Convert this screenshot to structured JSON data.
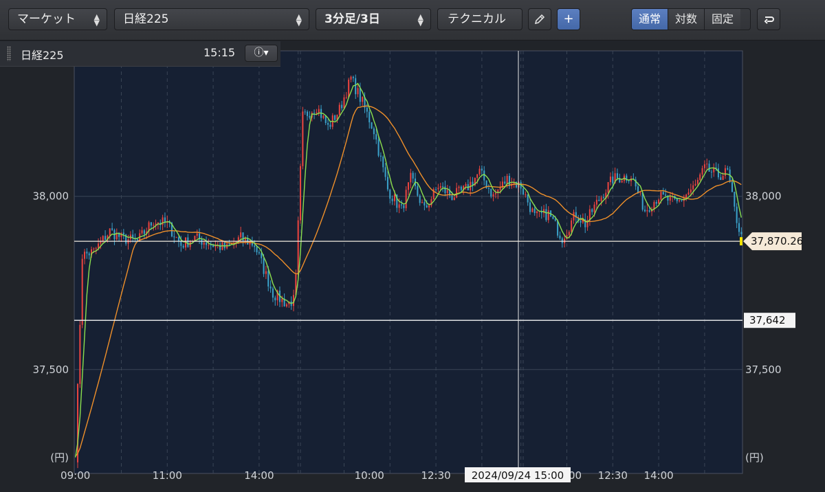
{
  "toolbar": {
    "market_label": "マーケット",
    "symbol_label": "日経225",
    "interval_label": "3分足/3日",
    "technical_label": "テクニカル",
    "scale_modes": [
      "通常",
      "対数",
      "固定"
    ],
    "active_scale_mode": "通常"
  },
  "info_bar": {
    "symbol": "日経225",
    "time": "15:15"
  },
  "crosshair_label": "2024/09/24 15:00",
  "colors": {
    "up": "#e8443f",
    "down": "#3aa0c8",
    "ma_short": "#8be04f",
    "ma_long": "#f0902a",
    "background": "#162033"
  },
  "chart_data": {
    "type": "candlestick",
    "unit": "(円)",
    "ylim": [
      37200,
      38420
    ],
    "y_ticks": [
      37500,
      38000
    ],
    "y_tick_labels": [
      "37,500",
      "38,000"
    ],
    "x_tick_labels": [
      "09:00",
      "11:00",
      "14:00",
      "10:00",
      "12:30",
      "10:00",
      "12:30",
      "14:00"
    ],
    "last_price": 37870.26,
    "last_price_label": "37,870.26",
    "reference_line": 37642,
    "reference_line_label": "37,642",
    "path_points": [
      [
        0,
        37250
      ],
      [
        3,
        37830
      ],
      [
        8,
        37840
      ],
      [
        15,
        37900
      ],
      [
        20,
        37880
      ],
      [
        27,
        37870
      ],
      [
        34,
        37930
      ],
      [
        40,
        37920
      ],
      [
        46,
        37860
      ],
      [
        52,
        37880
      ],
      [
        60,
        37860
      ],
      [
        66,
        37850
      ],
      [
        72,
        37880
      ],
      [
        78,
        37860
      ],
      [
        86,
        37720
      ],
      [
        92,
        37690
      ],
      [
        95,
        37700
      ],
      [
        96,
        37760
      ],
      [
        99,
        38230
      ],
      [
        105,
        38260
      ],
      [
        110,
        38200
      ],
      [
        115,
        38250
      ],
      [
        120,
        38340
      ],
      [
        125,
        38270
      ],
      [
        130,
        38190
      ],
      [
        136,
        38020
      ],
      [
        142,
        37960
      ],
      [
        146,
        38050
      ],
      [
        152,
        37960
      ],
      [
        158,
        38030
      ],
      [
        164,
        38000
      ],
      [
        170,
        38020
      ],
      [
        176,
        38070
      ],
      [
        182,
        38000
      ],
      [
        188,
        38050
      ],
      [
        194,
        38030
      ],
      [
        200,
        37940
      ],
      [
        206,
        37950
      ],
      [
        212,
        37880
      ],
      [
        218,
        37950
      ],
      [
        222,
        37920
      ],
      [
        226,
        37970
      ],
      [
        234,
        38050
      ],
      [
        242,
        38060
      ],
      [
        248,
        37960
      ],
      [
        254,
        38000
      ],
      [
        262,
        37980
      ],
      [
        270,
        38030
      ],
      [
        274,
        38080
      ],
      [
        280,
        38060
      ],
      [
        284,
        38070
      ],
      [
        287,
        37960
      ],
      [
        290,
        37880
      ]
    ]
  }
}
